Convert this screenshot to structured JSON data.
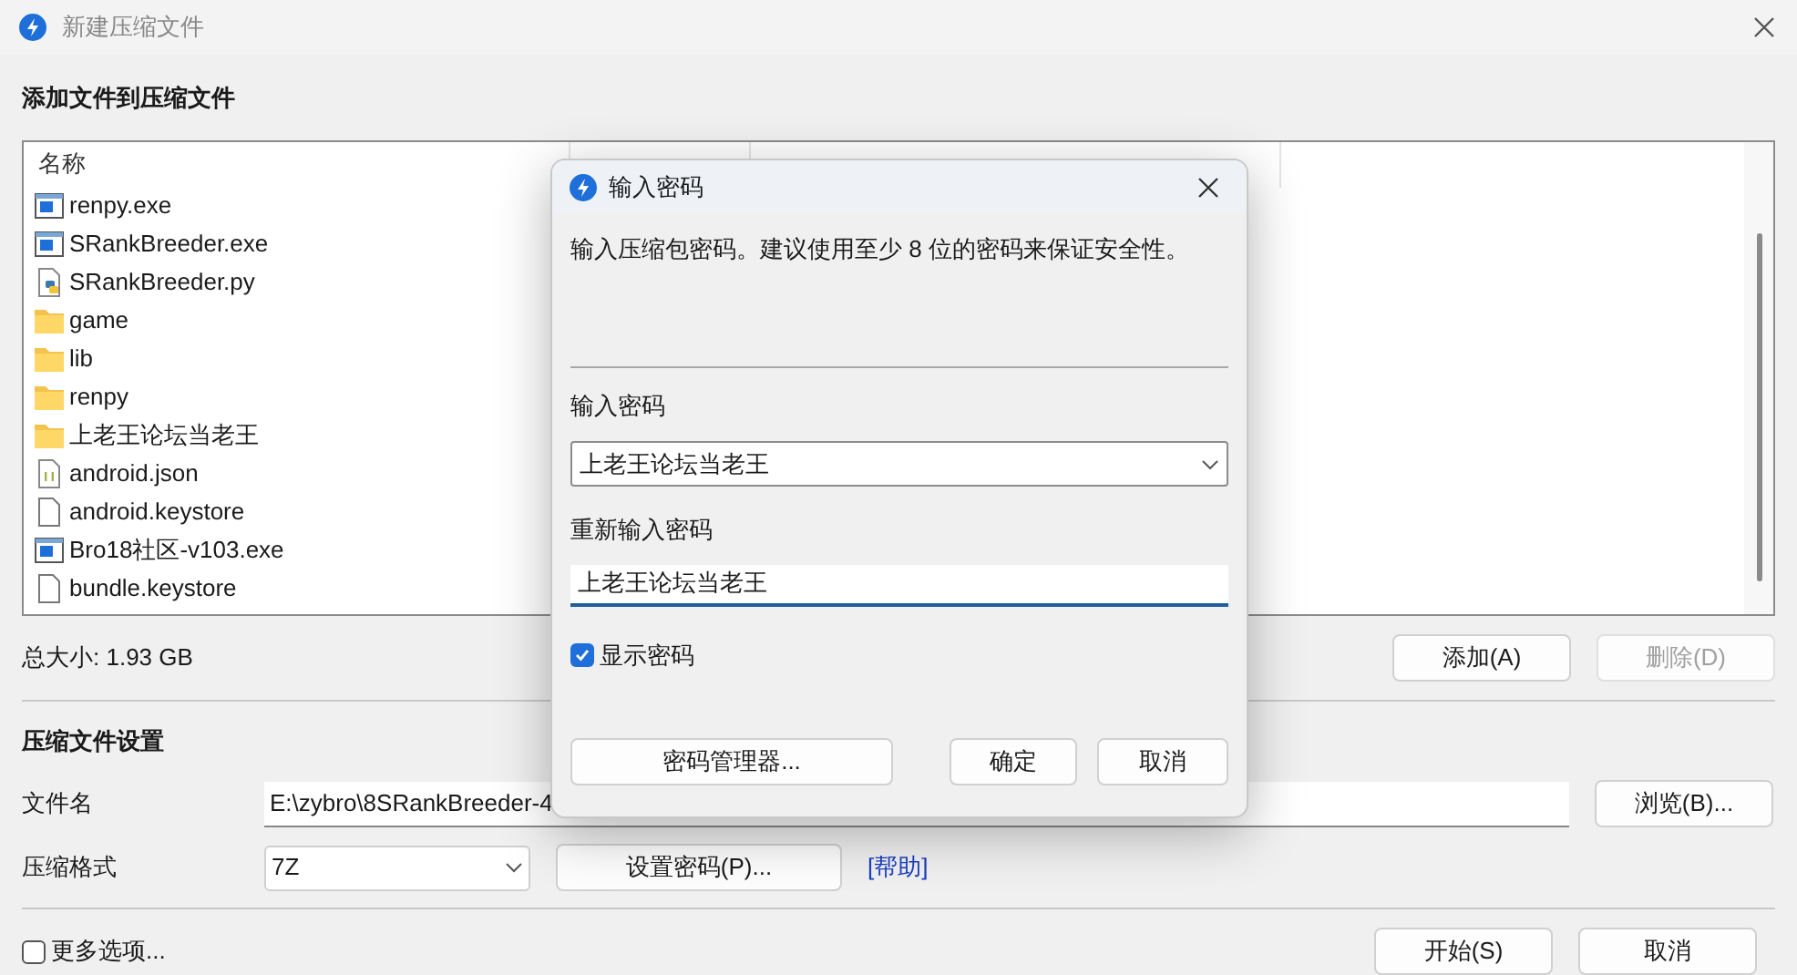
{
  "window": {
    "title": "新建压缩文件"
  },
  "add_section": {
    "heading": "添加文件到压缩文件",
    "columns": [
      "名称"
    ],
    "files": [
      {
        "name": "renpy.exe",
        "kind": "exe"
      },
      {
        "name": "SRankBreeder.exe",
        "kind": "exe"
      },
      {
        "name": "SRankBreeder.py",
        "kind": "py"
      },
      {
        "name": "game",
        "kind": "folder"
      },
      {
        "name": "lib",
        "kind": "folder"
      },
      {
        "name": "renpy",
        "kind": "folder"
      },
      {
        "name": "上老王论坛当老王",
        "kind": "folder"
      },
      {
        "name": "android.json",
        "kind": "json"
      },
      {
        "name": "android.keystore",
        "kind": "file"
      },
      {
        "name": "Bro18社区-v103.exe",
        "kind": "exe"
      },
      {
        "name": "bundle.keystore",
        "kind": "file"
      }
    ],
    "total_size": "总大小: 1.93 GB",
    "buttons": [
      {
        "label": "添加(A)",
        "disabled": false
      },
      {
        "label": "删除(D)",
        "disabled": true
      }
    ]
  },
  "settings": {
    "heading": "压缩文件设置",
    "filename_label": "文件名",
    "filename_value": "E:\\zybro\\8SRankBreeder-4",
    "browse_button": "浏览(B)...",
    "format_label": "压缩格式",
    "format_value": "7Z",
    "password_button": "设置密码(P)...",
    "help_link": "[帮助]"
  },
  "footer": {
    "more_options": {
      "label": "更多选项...",
      "checked": false
    },
    "buttons": [
      "开始(S)",
      "取消"
    ]
  },
  "dialog": {
    "title": "输入密码",
    "message": "输入压缩包密码。建议使用至少 8 位的密码来保证安全性。",
    "password_label": "输入密码",
    "password_value": "上老王论坛当老王",
    "confirm_label": "重新输入密码",
    "confirm_value": "上老王论坛当老王",
    "show_password": {
      "label": "显示密码",
      "checked": true
    },
    "manager_button": "密码管理器...",
    "buttons": [
      "确定",
      "取消"
    ]
  }
}
